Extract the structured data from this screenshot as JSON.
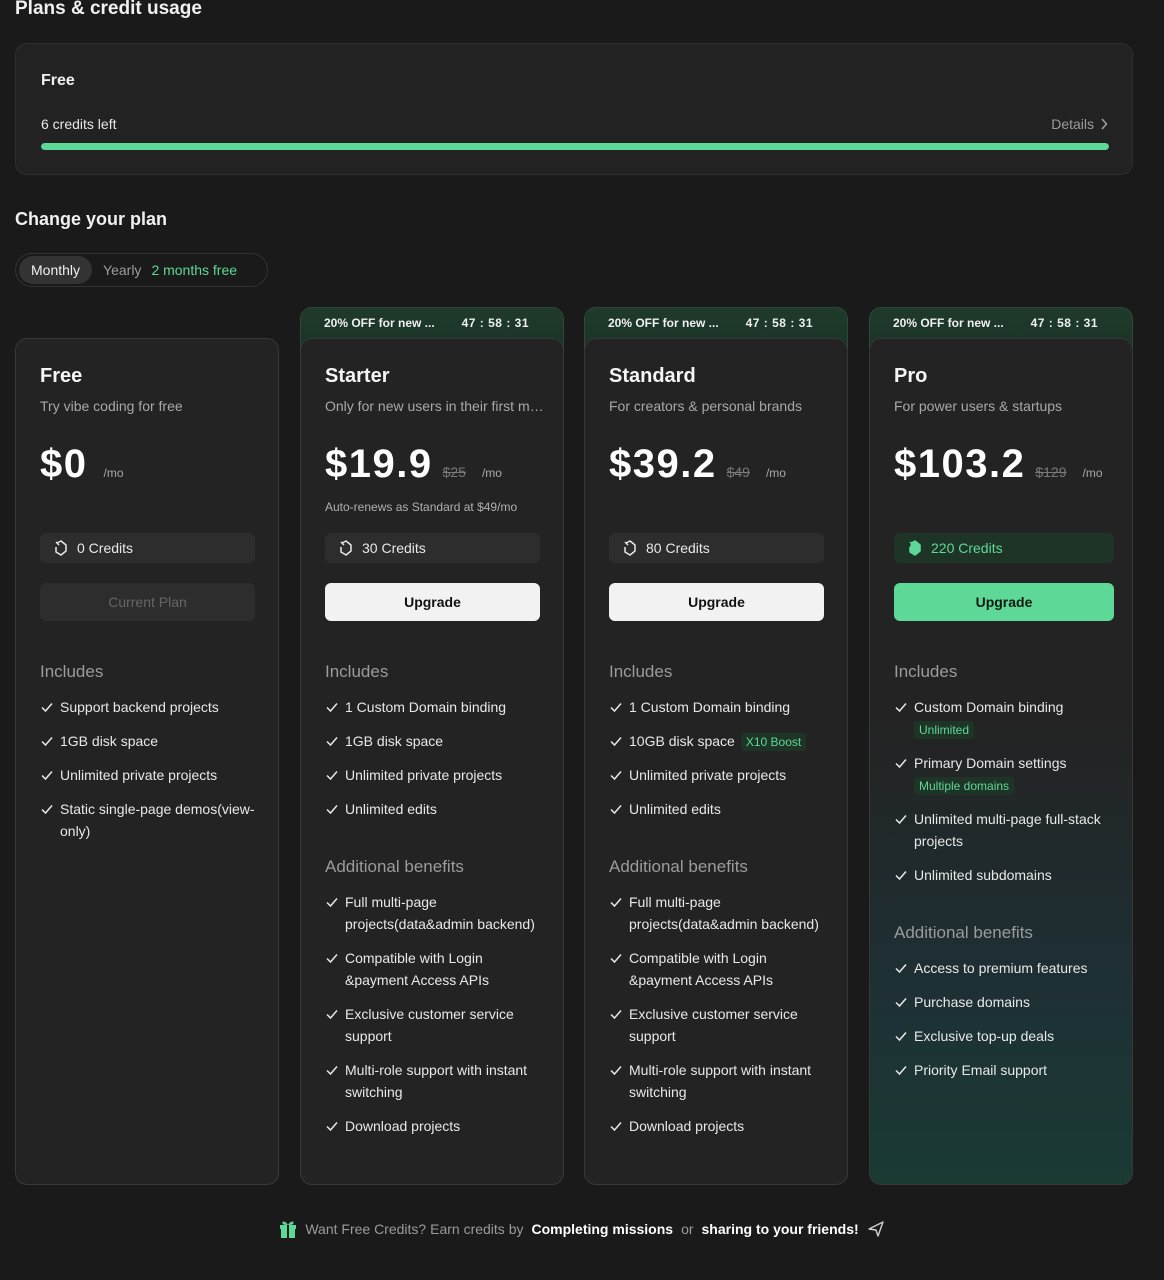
{
  "header": {
    "title": "Plans & credit usage"
  },
  "usage": {
    "plan": "Free",
    "credits_left": "6 credits left",
    "details_label": "Details",
    "progress_fraction": 1.0,
    "progress_color": "#5ed896"
  },
  "change_plan": {
    "title": "Change your plan",
    "toggle": {
      "monthly": "Monthly",
      "yearly": "Yearly",
      "yearly_promo": "2 months free",
      "selected": "Monthly"
    }
  },
  "promo": {
    "text": "20% OFF for new ...",
    "timer": "47 : 58 : 31"
  },
  "plans": [
    {
      "name": "Free",
      "tagline": "Try vibe coding for free",
      "price": "$0",
      "old_price": "",
      "per": "/mo",
      "renew_note": "",
      "credits": "0 Credits",
      "button": "Current Plan",
      "includes_title": "Includes",
      "includes": [
        {
          "text": "Support backend projects"
        },
        {
          "text": "1GB disk space"
        },
        {
          "text": "Unlimited private projects"
        },
        {
          "text": "Static single-page demos(view-only)"
        }
      ],
      "benefits_title": "",
      "benefits": []
    },
    {
      "name": "Starter",
      "tagline": "Only for new users in their first month",
      "price": "$19.9",
      "old_price": "$25",
      "per": "/mo",
      "renew_note": "Auto-renews as Standard at $49/mo",
      "credits": "30 Credits",
      "button": "Upgrade",
      "includes_title": "Includes",
      "includes": [
        {
          "text": "1 Custom Domain binding"
        },
        {
          "text": "1GB disk space"
        },
        {
          "text": "Unlimited private projects"
        },
        {
          "text": "Unlimited edits"
        }
      ],
      "benefits_title": "Additional benefits",
      "benefits": [
        {
          "text": "Full multi-page projects(data&admin backend)"
        },
        {
          "text": "Compatible with Login &payment Access APIs"
        },
        {
          "text": "Exclusive customer service support"
        },
        {
          "text": "Multi-role support with instant switching"
        },
        {
          "text": "Download projects"
        }
      ]
    },
    {
      "name": "Standard",
      "tagline": "For creators & personal brands",
      "price": "$39.2",
      "old_price": "$49",
      "per": "/mo",
      "renew_note": "",
      "credits": "80 Credits",
      "button": "Upgrade",
      "includes_title": "Includes",
      "includes": [
        {
          "text": "1 Custom Domain binding"
        },
        {
          "text": "10GB disk space",
          "tag": "X10 Boost"
        },
        {
          "text": "Unlimited private projects"
        },
        {
          "text": "Unlimited edits"
        }
      ],
      "benefits_title": "Additional benefits",
      "benefits": [
        {
          "text": "Full multi-page projects(data&admin backend)"
        },
        {
          "text": "Compatible with Login &payment Access APIs"
        },
        {
          "text": "Exclusive customer service support"
        },
        {
          "text": "Multi-role support with instant switching"
        },
        {
          "text": "Download projects"
        }
      ]
    },
    {
      "name": "Pro",
      "tagline": "For power users & startups",
      "price": "$103.2",
      "old_price": "$129",
      "per": "/mo",
      "renew_note": "",
      "credits": "220 Credits",
      "button": "Upgrade",
      "includes_title": "Includes",
      "includes": [
        {
          "text": "Custom Domain binding",
          "sub": "Unlimited"
        },
        {
          "text": "Primary Domain settings",
          "sub": "Multiple domains"
        },
        {
          "text": "Unlimited multi-page full-stack projects"
        },
        {
          "text": "Unlimited subdomains"
        }
      ],
      "benefits_title": "Additional benefits",
      "benefits": [
        {
          "text": "Access to premium features"
        },
        {
          "text": "Purchase domains"
        },
        {
          "text": "Exclusive top-up deals"
        },
        {
          "text": "Priority Email support"
        }
      ]
    }
  ],
  "footer": {
    "prefix": "Want Free Credits? Earn credits by",
    "missions": "Completing missions",
    "or": "or",
    "share": "sharing to your friends!"
  },
  "colors": {
    "accent": "#5ed896",
    "background": "#1a1a1a",
    "card": "#232323"
  },
  "icons": {
    "credit": "credit-coin-icon",
    "check": "check-icon",
    "gift": "gift-icon",
    "arrow": "send-arrow-icon",
    "chevron": "chevron-right-icon"
  }
}
